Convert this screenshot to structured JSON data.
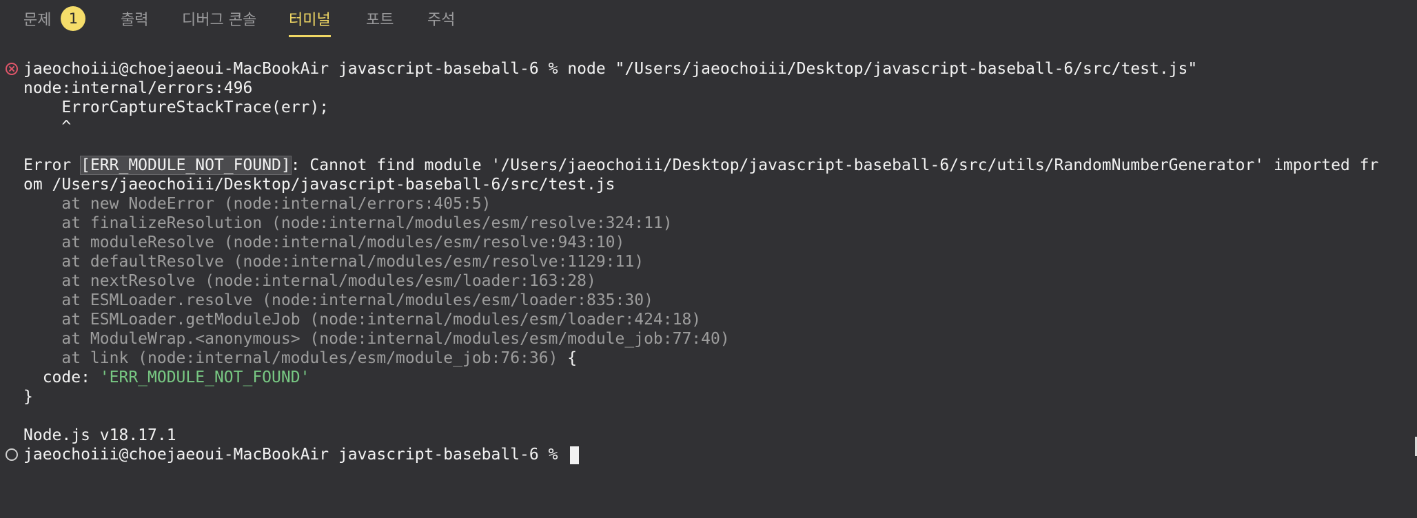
{
  "tabs": [
    {
      "label": "문제",
      "badge": "1"
    },
    {
      "label": "출력"
    },
    {
      "label": "디버그 콘솔"
    },
    {
      "label": "터미널",
      "active": true
    },
    {
      "label": "포트"
    },
    {
      "label": "주석"
    }
  ],
  "terminal": {
    "command_line": {
      "prompt": "jaeochoiii@choejaeoui-MacBookAir javascript-baseball-6 %",
      "command": "node \"/Users/jaeochoiii/Desktop/javascript-baseball-6/src/test.js\""
    },
    "error_location": "node:internal/errors:496",
    "error_source": "    ErrorCaptureStackTrace(err);",
    "error_caret": "    ^",
    "error_prefix": "Error ",
    "error_code": "[ERR_MODULE_NOT_FOUND]",
    "error_message_1": ": Cannot find module '/Users/jaeochoiii/Desktop/javascript-baseball-6/src/utils/RandomNumberGenerator' imported fr",
    "error_message_2": "om /Users/jaeochoiii/Desktop/javascript-baseball-6/src/test.js",
    "stack": [
      "    at new NodeError (node:internal/errors:405:5)",
      "    at finalizeResolution (node:internal/modules/esm/resolve:324:11)",
      "    at moduleResolve (node:internal/modules/esm/resolve:943:10)",
      "    at defaultResolve (node:internal/modules/esm/resolve:1129:11)",
      "    at nextResolve (node:internal/modules/esm/loader:163:28)",
      "    at ESMLoader.resolve (node:internal/modules/esm/loader:835:30)",
      "    at ESMLoader.getModuleJob (node:internal/modules/esm/loader:424:18)",
      "    at ModuleWrap.<anonymous> (node:internal/modules/esm/module_job:77:40)",
      "    at link (node:internal/modules/esm/module_job:76:36)"
    ],
    "stack_tail": " {",
    "code_key": "  code: ",
    "code_value": "'ERR_MODULE_NOT_FOUND'",
    "close_brace": "}",
    "node_version": "Node.js v18.17.1",
    "final_prompt": "jaeochoiii@choejaeoui-MacBookAir javascript-baseball-6 %"
  },
  "colors": {
    "background": "#313134",
    "active_tab": "#f0d764",
    "error_marker": "#e0566a",
    "string_value": "#78c883"
  },
  "icons": {
    "error_gutter": "error-circle-icon",
    "prompt_gutter": "success-circle-icon"
  }
}
